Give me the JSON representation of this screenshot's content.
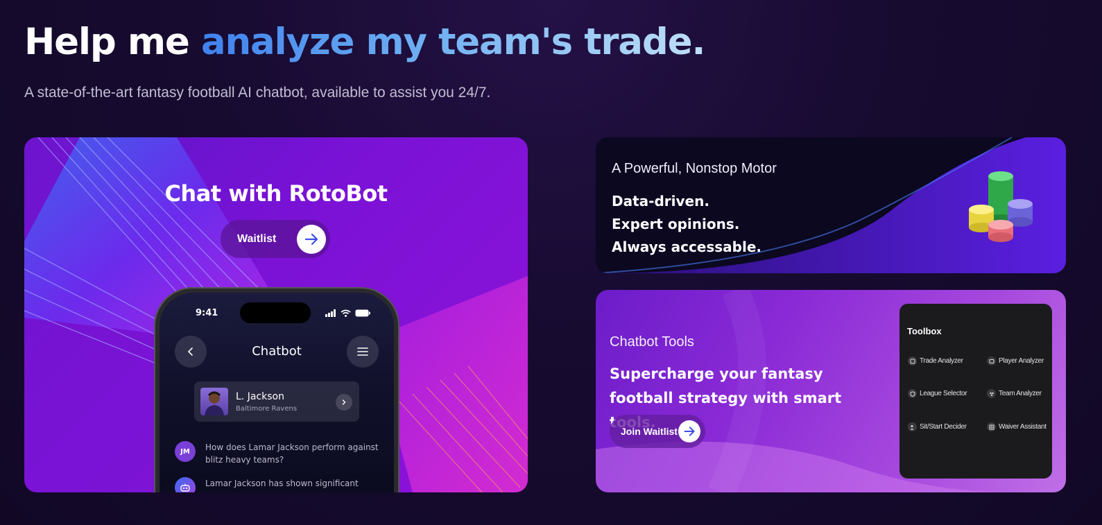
{
  "hero": {
    "title_prefix": "Help me ",
    "title_accent": "analyze my team's trade.",
    "subtitle": "A state-of-the-art fantasy football AI chatbot, available to assist you 24/7."
  },
  "chat_card": {
    "title": "Chat with RotoBot",
    "button_label": "Waitlist",
    "phone": {
      "time": "9:41",
      "screen_title": "Chatbot",
      "player_name": "L. Jackson",
      "player_team": "Baltimore Ravens",
      "user_initials": "JM",
      "user_message": "How does Lamar Jackson perform against blitz heavy teams?",
      "bot_message": "Lamar Jackson has shown significant"
    }
  },
  "motor_card": {
    "kicker": "A Powerful, Nonstop Motor",
    "lines": [
      "Data-driven.",
      "Expert opinions.",
      "Always accessable."
    ]
  },
  "tools_card": {
    "kicker": "Chatbot Tools",
    "headline": "Supercharge your fantasy football strategy with smart tools.",
    "button_label": "Join Waitlist",
    "toolbox": {
      "title": "Toolbox",
      "tools": [
        {
          "label": "Trade Analyzer",
          "icon": "trade-icon"
        },
        {
          "label": "Player Analyzer",
          "icon": "player-icon"
        },
        {
          "label": "League Selector",
          "icon": "shield-icon"
        },
        {
          "label": "Team Analyzer",
          "icon": "team-icon"
        },
        {
          "label": "Sit/Start Decider",
          "icon": "decider-icon"
        },
        {
          "label": "Waiver Assistant",
          "icon": "waiver-icon"
        }
      ]
    }
  },
  "colors": {
    "accent_blue": "#3f82ee",
    "purple": "#7a12d6",
    "background": "#170b30"
  }
}
